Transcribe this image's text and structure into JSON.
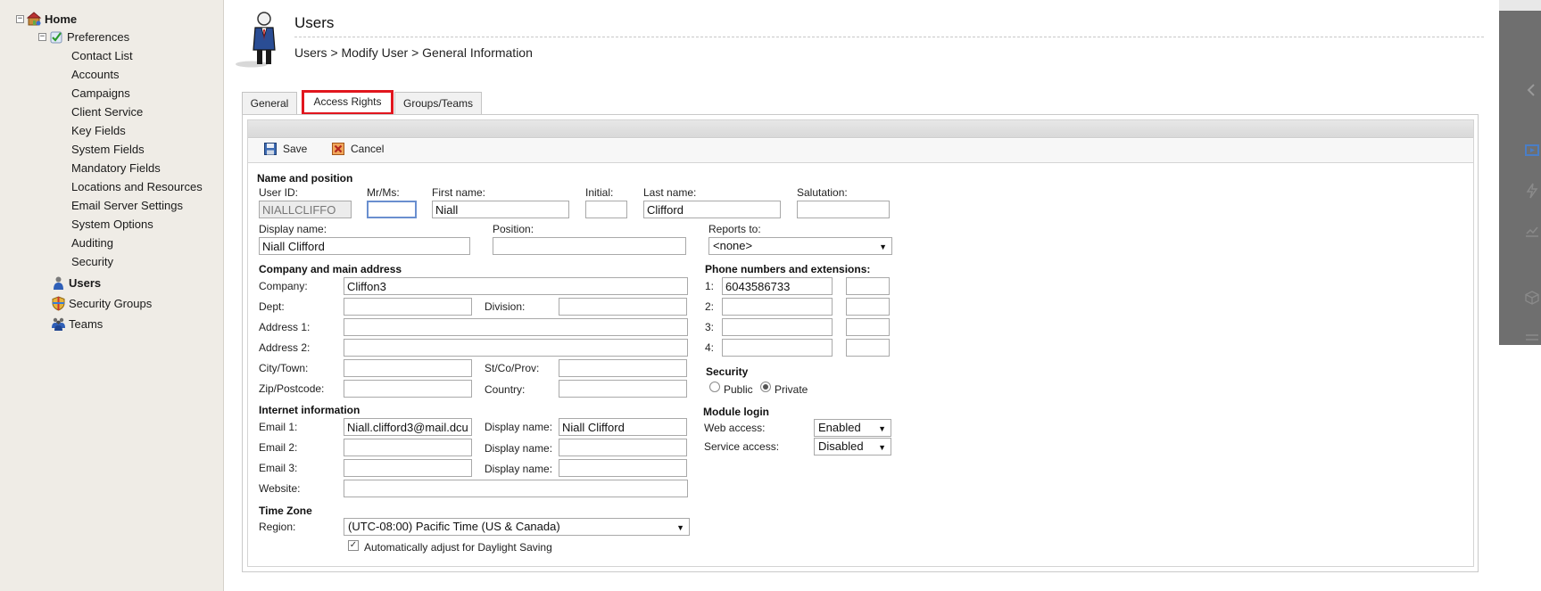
{
  "sidebar": {
    "home": "Home",
    "preferences": "Preferences",
    "preference_items": [
      "Contact List",
      "Accounts",
      "Campaigns",
      "Client Service",
      "Key Fields",
      "System Fields",
      "Mandatory Fields",
      "Locations and Resources",
      "Email Server Settings",
      "System Options",
      "Auditing",
      "Security"
    ],
    "users": "Users",
    "security_groups": "Security Groups",
    "teams": "Teams"
  },
  "header": {
    "title": "Users",
    "breadcrumb": "Users > Modify User > General Information"
  },
  "tabs": [
    {
      "label": "General"
    },
    {
      "label": "Access Rights"
    },
    {
      "label": "Groups/Teams"
    }
  ],
  "toolbar": {
    "save": "Save",
    "cancel": "Cancel"
  },
  "form": {
    "name_section": "Name and position",
    "user_id_label": "User ID:",
    "user_id": "NIALLCLIFFO",
    "mrms_label": "Mr/Ms:",
    "mrms": "",
    "first_name_label": "First name:",
    "first_name": "Niall",
    "initial_label": "Initial:",
    "initial": "",
    "last_name_label": "Last name:",
    "last_name": "Clifford",
    "salutation_label": "Salutation:",
    "salutation": "",
    "display_name_label": "Display name:",
    "display_name": "Niall Clifford",
    "position_label": "Position:",
    "position": "",
    "reports_to_label": "Reports to:",
    "reports_to": "<none>",
    "company_section": "Company and main address",
    "company_label": "Company:",
    "company": "Cliffon3",
    "dept_label": "Dept:",
    "dept": "",
    "division_label": "Division:",
    "division": "",
    "address1_label": "Address 1:",
    "address1": "",
    "address2_label": "Address 2:",
    "address2": "",
    "city_label": "City/Town:",
    "city": "",
    "state_label": "St/Co/Prov:",
    "state": "",
    "zip_label": "Zip/Postcode:",
    "zip": "",
    "country_label": "Country:",
    "country": "",
    "internet_section": "Internet information",
    "email1_label": "Email 1:",
    "email1": "Niall.clifford3@mail.dcu",
    "email1_display_label": "Display name:",
    "email1_display": "Niall Clifford",
    "email2_label": "Email 2:",
    "email2": "",
    "email2_display_label": "Display name:",
    "email2_display": "",
    "email3_label": "Email 3:",
    "email3": "",
    "email3_display_label": "Display name:",
    "email3_display": "",
    "website_label": "Website:",
    "website": "",
    "timezone_section": "Time Zone",
    "region_label": "Region:",
    "region": "(UTC-08:00) Pacific Time (US & Canada)",
    "dst_label": "Automatically adjust for Daylight Saving",
    "dst_checked": true,
    "phone_section": "Phone numbers and extensions:",
    "phones": [
      {
        "label": "1:",
        "number": "6043586733",
        "ext": ""
      },
      {
        "label": "2:",
        "number": "",
        "ext": ""
      },
      {
        "label": "3:",
        "number": "",
        "ext": ""
      },
      {
        "label": "4:",
        "number": "",
        "ext": ""
      }
    ],
    "security_section": "Security",
    "public_label": "Public",
    "private_label": "Private",
    "security_value": "Private",
    "module_section": "Module login",
    "web_access_label": "Web access:",
    "web_access": "Enabled",
    "service_access_label": "Service access:",
    "service_access": "Disabled"
  },
  "colors": {
    "active_tab_border": "#e1161e",
    "sidebar_bg": "#efece6",
    "right_strip": "#6f6f6f"
  }
}
